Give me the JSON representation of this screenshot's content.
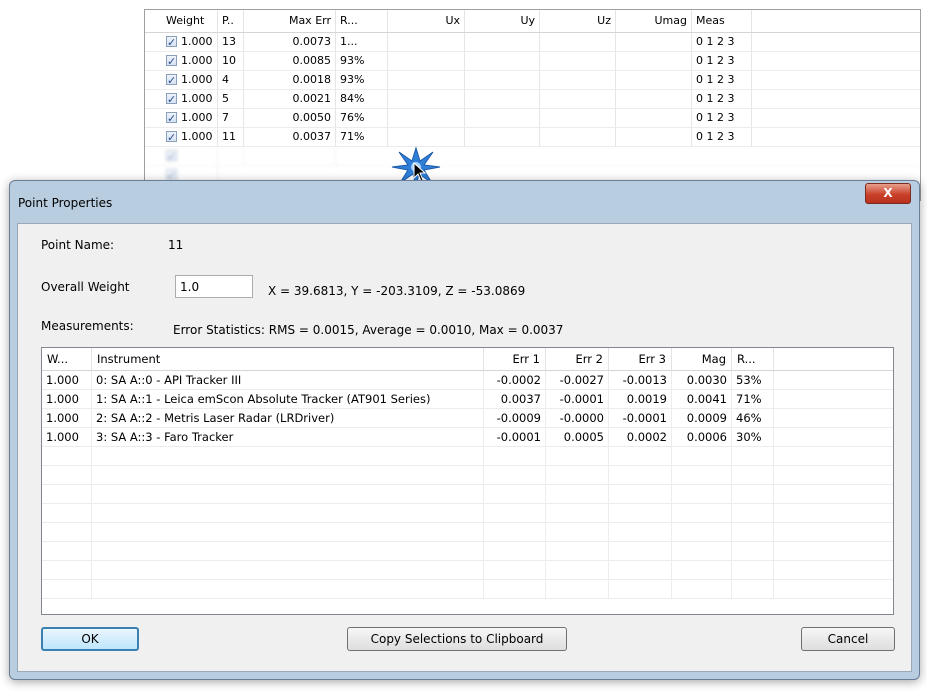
{
  "background_grid": {
    "columns": [
      "Weight",
      "P..",
      "Max Err",
      "R...",
      "Ux",
      "Uy",
      "Uz",
      "Umag",
      "Meas"
    ],
    "rows": [
      {
        "weight": "1.000",
        "point": "13",
        "max_err": "0.0073",
        "r": "1...",
        "meas": "0 1 2 3"
      },
      {
        "weight": "1.000",
        "point": "10",
        "max_err": "0.0085",
        "r": "93%",
        "meas": "0 1 2 3"
      },
      {
        "weight": "1.000",
        "point": "4",
        "max_err": "0.0018",
        "r": "93%",
        "meas": "0 1 2 3"
      },
      {
        "weight": "1.000",
        "point": "5",
        "max_err": "0.0021",
        "r": "84%",
        "meas": "0 1 2 3"
      },
      {
        "weight": "1.000",
        "point": "7",
        "max_err": "0.0050",
        "r": "76%",
        "meas": "0 1 2 3"
      },
      {
        "weight": "1.000",
        "point": "11",
        "max_err": "0.0037",
        "r": "71%",
        "meas": "0 1 2 3"
      }
    ]
  },
  "dialog": {
    "title": "Point Properties",
    "close_glyph": "X",
    "point_name_label": "Point Name:",
    "point_name_value": "11",
    "overall_weight_label": "Overall Weight",
    "overall_weight_value": "1.0",
    "coordinates": "X = 39.6813, Y = -203.3109, Z = -53.0869",
    "measurements_label": "Measurements:",
    "error_stats": "Error Statistics: RMS = 0.0015, Average = 0.0010, Max = 0.0037",
    "table": {
      "columns": [
        "W...",
        "Instrument",
        "Err 1",
        "Err 2",
        "Err 3",
        "Mag",
        "R..."
      ],
      "rows": [
        {
          "w": "1.000",
          "instrument": "0: SA A::0 - API Tracker III",
          "err1": "-0.0002",
          "err2": "-0.0027",
          "err3": "-0.0013",
          "mag": "0.0030",
          "r": "53%"
        },
        {
          "w": "1.000",
          "instrument": "1: SA A::1 - Leica emScon Absolute Tracker (AT901 Series)",
          "err1": "0.0037",
          "err2": "-0.0001",
          "err3": "0.0019",
          "mag": "0.0041",
          "r": "71%"
        },
        {
          "w": "1.000",
          "instrument": "2: SA A::2 - Metris Laser Radar (LRDriver)",
          "err1": "-0.0009",
          "err2": "-0.0000",
          "err3": "-0.0001",
          "mag": "0.0009",
          "r": "46%"
        },
        {
          "w": "1.000",
          "instrument": "3: SA A::3 - Faro Tracker",
          "err1": "-0.0001",
          "err2": "0.0005",
          "err3": "0.0002",
          "mag": "0.0006",
          "r": "30%"
        }
      ]
    },
    "buttons": {
      "ok": "OK",
      "copy": "Copy Selections to Clipboard",
      "cancel": "Cancel"
    }
  },
  "colors": {
    "dialog_frame": "#b9cde0",
    "client_bg": "#f0f0f0",
    "close_button": "#c9412b",
    "default_button_border": "#3c7fb1"
  }
}
